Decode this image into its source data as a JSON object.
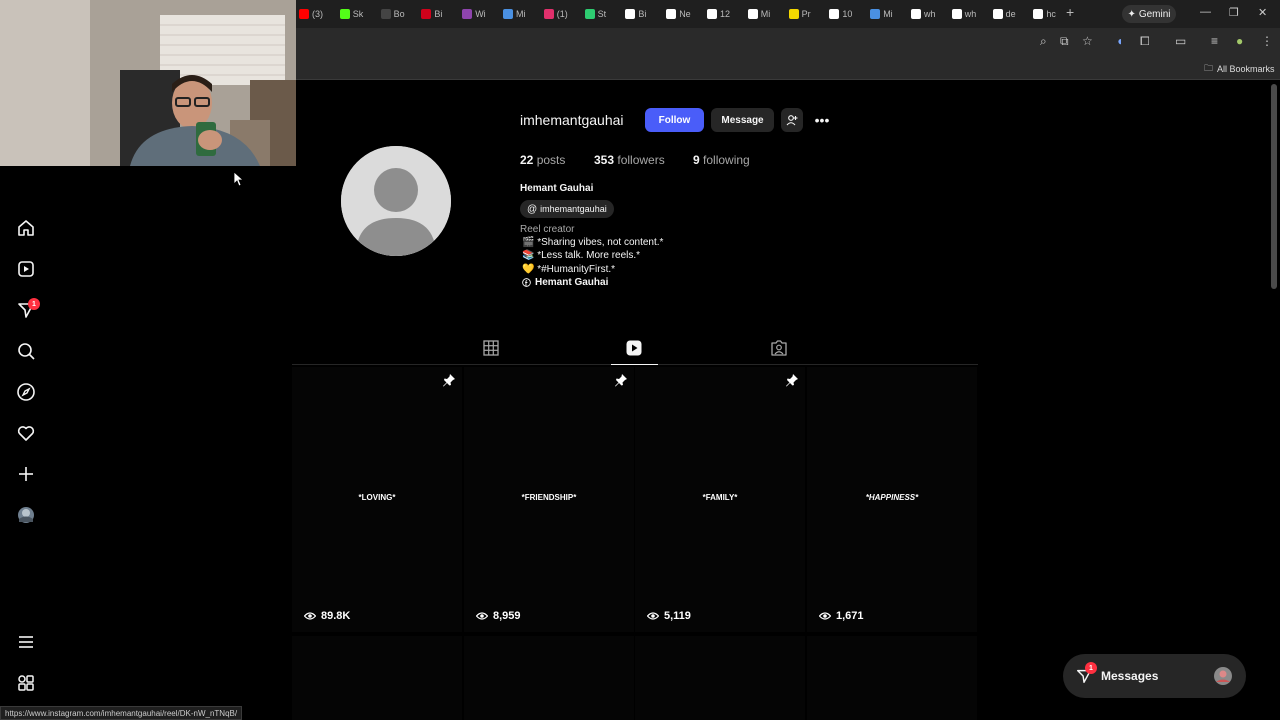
{
  "browser": {
    "tabs": [
      {
        "label": "(3)",
        "color": "#ff0000"
      },
      {
        "label": "Sk",
        "color": "#53fc18"
      },
      {
        "label": "Bo",
        "color": "#444444"
      },
      {
        "label": "Bi",
        "color": "#d0021b"
      },
      {
        "label": "Wi",
        "color": "#8e44ad"
      },
      {
        "label": "Mi",
        "color": "#4a90e2"
      },
      {
        "label": "(1)",
        "color": "#e1306c"
      },
      {
        "label": "St",
        "color": "#2ecc71"
      },
      {
        "label": "Bi",
        "color": "#ffffff"
      },
      {
        "label": "Ne",
        "color": "#ffffff"
      },
      {
        "label": "12",
        "color": "#ffffff"
      },
      {
        "label": "Mi",
        "color": "#ffffff"
      },
      {
        "label": "Pr",
        "color": "#f5d800"
      },
      {
        "label": "10",
        "color": "#ffffff"
      },
      {
        "label": "Mi",
        "color": "#4a90e2"
      },
      {
        "label": "wh",
        "color": "#ffffff"
      },
      {
        "label": "wh",
        "color": "#ffffff"
      },
      {
        "label": "de",
        "color": "#ffffff"
      },
      {
        "label": "hc",
        "color": "#ffffff"
      }
    ],
    "gemini_label": "Gemini",
    "all_bookmarks": "All Bookmarks",
    "status_url": "https://www.instagram.com/imhemantgauhai/reel/DK-nW_nTNqB/"
  },
  "profile": {
    "username": "imhemantgauhai",
    "follow_label": "Follow",
    "message_label": "Message",
    "stats": {
      "posts_count": "22",
      "posts_label": "posts",
      "followers_count": "353",
      "followers_label": "followers",
      "following_count": "9",
      "following_label": "following"
    },
    "full_name": "Hemant Gauhai",
    "threads_handle": "imhemantgauhai",
    "category": "Reel creator",
    "bio": [
      "🎬 *Sharing vibes, not content.*",
      "📚 *Less talk. More reels.*",
      "💛 *#HumanityFirst.*"
    ],
    "facebook_link": "Hemant Gauhai"
  },
  "sidebar": {
    "notification_count": "1"
  },
  "reels": [
    {
      "title": "*LOVING*",
      "views": "89.8K",
      "pinned": true
    },
    {
      "title": "*FRIENDSHIP*",
      "views": "8,959",
      "pinned": true
    },
    {
      "title": "*FAMILY*",
      "views": "5,119",
      "pinned": true
    },
    {
      "title": "*HAPPINESS*",
      "views": "1,671",
      "pinned": false
    }
  ],
  "messages": {
    "label": "Messages",
    "badge": "1"
  },
  "colors": {
    "accent": "#4a5df9",
    "badge": "#ff3040"
  }
}
